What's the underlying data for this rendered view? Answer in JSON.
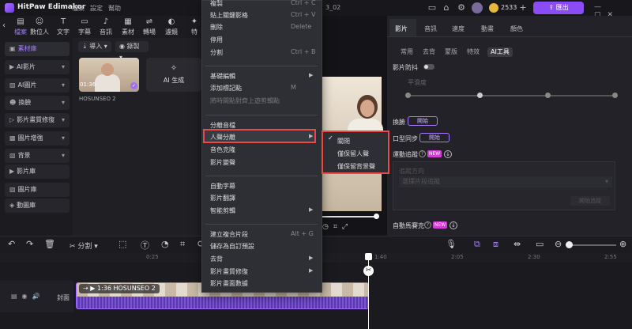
{
  "titlebar": {
    "app_name": "HitPaw Edimakor",
    "menus": [
      "檔案",
      "設定",
      "幫助"
    ],
    "project_title": "3_02",
    "coins": "2533",
    "export_label": "匯出"
  },
  "top_tabs": [
    {
      "label": "檔案",
      "icon": "file-icon",
      "glyph": "▤"
    },
    {
      "label": "數位人",
      "icon": "digital-human-icon",
      "glyph": "☺"
    },
    {
      "label": "文字",
      "icon": "text-icon",
      "glyph": "T"
    },
    {
      "label": "字幕",
      "icon": "subtitle-icon",
      "glyph": "▭"
    },
    {
      "label": "音訊",
      "icon": "audio-icon",
      "glyph": "♪"
    },
    {
      "label": "素材",
      "icon": "material-icon",
      "glyph": "▦"
    },
    {
      "label": "轉場",
      "icon": "transition-icon",
      "glyph": "⇌"
    },
    {
      "label": "濾鏡",
      "icon": "filter-icon",
      "glyph": "◐"
    },
    {
      "label": "特",
      "icon": "effect-icon",
      "glyph": "✦"
    }
  ],
  "sidebar": {
    "items": [
      {
        "label": "素材庫",
        "icon": "library-icon",
        "glyph": "▣"
      },
      {
        "label": "AI影片",
        "icon": "ai-video-icon",
        "glyph": "▶"
      },
      {
        "label": "AI圖片",
        "icon": "ai-image-icon",
        "glyph": "▨"
      },
      {
        "label": "換臉",
        "icon": "face-swap-icon",
        "glyph": "☻"
      },
      {
        "label": "影片畫質修復",
        "icon": "video-enhance-icon",
        "glyph": "▷"
      },
      {
        "label": "圖片增強",
        "icon": "image-enhance-icon",
        "glyph": "▩"
      },
      {
        "label": "背景",
        "icon": "background-icon",
        "glyph": "▧"
      },
      {
        "label": "影片庫",
        "icon": "video-library-icon",
        "glyph": "▶"
      },
      {
        "label": "圖片庫",
        "icon": "image-library-icon",
        "glyph": "▨"
      },
      {
        "label": "動圖庫",
        "icon": "gif-library-icon",
        "glyph": "◈"
      }
    ]
  },
  "media": {
    "import_label": "導入",
    "record_label": "錄製",
    "thumb_duration": "01:36",
    "thumb_name": "HOSUNSEO 2",
    "ai_generate_label": "AI 生成"
  },
  "right_panel": {
    "tabs": [
      "影片",
      "音訊",
      "速度",
      "動畫",
      "顏色"
    ],
    "subtabs": [
      "常用",
      "去背",
      "蒙版",
      "特效",
      "AI工具"
    ],
    "stabilize_label": "影片防抖",
    "smoothness_label": "平滑度",
    "face_swap_label": "換臉",
    "start_label": "開始",
    "lipsync_label": "口型同步",
    "motion_track_label": "運動追蹤",
    "new_badge": "NEW",
    "track_direction_label": "追蹤方向",
    "track_select_placeholder": "選擇片段追蹤",
    "track_start_label": "開始追蹤",
    "auto_mosaic_label": "自動馬賽克"
  },
  "timeline": {
    "split_label": "分割",
    "ticks": [
      "0:25",
      "1:40",
      "2:05",
      "2:30",
      "2:55"
    ],
    "cover_label": "封面",
    "clip_label": "1:36 HOSUNSEO 2"
  },
  "context_menu": {
    "items": [
      {
        "label": "複製",
        "shortcut": "Ctrl + C"
      },
      {
        "label": "貼上關鍵影格",
        "shortcut": "Ctrl + V"
      },
      {
        "label": "刪除",
        "shortcut": "Delete"
      },
      {
        "label": "停用",
        "shortcut": ""
      },
      {
        "label": "分割",
        "shortcut": "Ctrl + B"
      },
      {
        "label": "基礎編輯",
        "shortcut": ""
      },
      {
        "label": "添加標記點",
        "shortcut": "M"
      },
      {
        "label": "將時間點對齊上遊剪輯點",
        "shortcut": ""
      },
      {
        "label": "分離音檔",
        "shortcut": ""
      },
      {
        "label": "人聲分離",
        "shortcut": ""
      },
      {
        "label": "音色克隆",
        "shortcut": ""
      },
      {
        "label": "影片變聲",
        "shortcut": ""
      },
      {
        "label": "自動字幕",
        "shortcut": ""
      },
      {
        "label": "影片翻譯",
        "shortcut": ""
      },
      {
        "label": "智能剪輯",
        "shortcut": ""
      },
      {
        "label": "建立複合片段",
        "shortcut": "Alt + G"
      },
      {
        "label": "儲存為自訂預設",
        "shortcut": ""
      },
      {
        "label": "去背",
        "shortcut": ""
      },
      {
        "label": "影片畫質修復",
        "shortcut": ""
      },
      {
        "label": "影片畫面數據",
        "shortcut": ""
      }
    ],
    "submenu": [
      "關閉",
      "僅保留人聲",
      "僅保留背景聲"
    ]
  }
}
